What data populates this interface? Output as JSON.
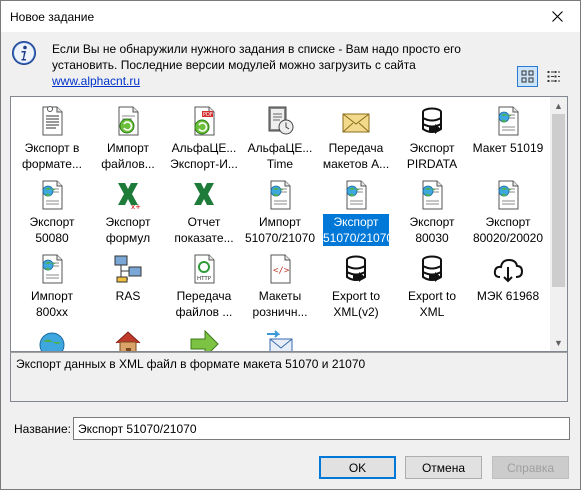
{
  "window": {
    "title": "Новое задание"
  },
  "info": {
    "text_line1": "Если Вы не обнаружили нужного задания в списке - Вам надо просто его",
    "text_line2": "установить. Последние версии модулей можно загрузить с сайта",
    "link": "www.alphacnt.ru"
  },
  "items": [
    {
      "line1": "Экспорт в",
      "line2": "формате...",
      "icon": "document-lines-icon"
    },
    {
      "line1": "Импорт",
      "line2": "файлов...",
      "icon": "document-recycle-icon"
    },
    {
      "line1": "АльфаЦЕ...",
      "line2": "Экспорт-И...",
      "icon": "document-pdf-recycle-icon"
    },
    {
      "line1": "АльфаЦЕ...",
      "line2": "Time",
      "icon": "document-clock-icon"
    },
    {
      "line1": "Передача",
      "line2": "макетов А...",
      "icon": "envelope-icon"
    },
    {
      "line1": "Экспорт",
      "line2": "PIRDATA",
      "icon": "database-export-icon"
    },
    {
      "line1": "Макет 51019",
      "line2": "",
      "icon": "document-globe-icon"
    },
    {
      "line1": "Экспорт",
      "line2": "50080",
      "icon": "document-globe-icon"
    },
    {
      "line1": "Экспорт",
      "line2": "формул",
      "icon": "excel-export-icon"
    },
    {
      "line1": "Отчет",
      "line2": "показате...",
      "icon": "excel-icon"
    },
    {
      "line1": "Импорт",
      "line2": "51070/21070",
      "icon": "document-globe-icon"
    },
    {
      "line1": "Экспорт",
      "line2": "51070/21070",
      "icon": "document-globe-icon",
      "selected": true
    },
    {
      "line1": "Экспорт",
      "line2": "80030",
      "icon": "document-globe-icon"
    },
    {
      "line1": "Экспорт",
      "line2": "80020/20020",
      "icon": "document-globe-icon"
    },
    {
      "line1": "Импорт",
      "line2": "800xx",
      "icon": "document-globe-icon"
    },
    {
      "line1": "RAS",
      "line2": "",
      "icon": "network-computers-icon"
    },
    {
      "line1": "Передача",
      "line2": "файлов ...",
      "icon": "http-document-icon"
    },
    {
      "line1": "Макеты",
      "line2": "розничн...",
      "icon": "code-document-icon"
    },
    {
      "line1": "Export to",
      "line2": "XML(v2)",
      "icon": "database-export-icon"
    },
    {
      "line1": "Export to",
      "line2": "XML",
      "icon": "database-export-icon"
    },
    {
      "line1": "МЭК 61968",
      "line2": "",
      "icon": "cloud-download-icon"
    },
    {
      "line1": "",
      "line2": "",
      "icon": "globe-arrows-icon"
    },
    {
      "line1": "",
      "line2": "",
      "icon": "house-icon"
    },
    {
      "line1": "",
      "line2": "",
      "icon": "green-arrow-icon"
    },
    {
      "line1": "",
      "line2": "",
      "icon": "envelope-arrows-icon"
    }
  ],
  "description": "Экспорт данных в XML файл в формате макета 51070 и 21070",
  "name_field": {
    "label": "Название:",
    "value": "Экспорт 51070/21070"
  },
  "buttons": {
    "ok": "OK",
    "cancel": "Отмена",
    "help": "Справка"
  }
}
